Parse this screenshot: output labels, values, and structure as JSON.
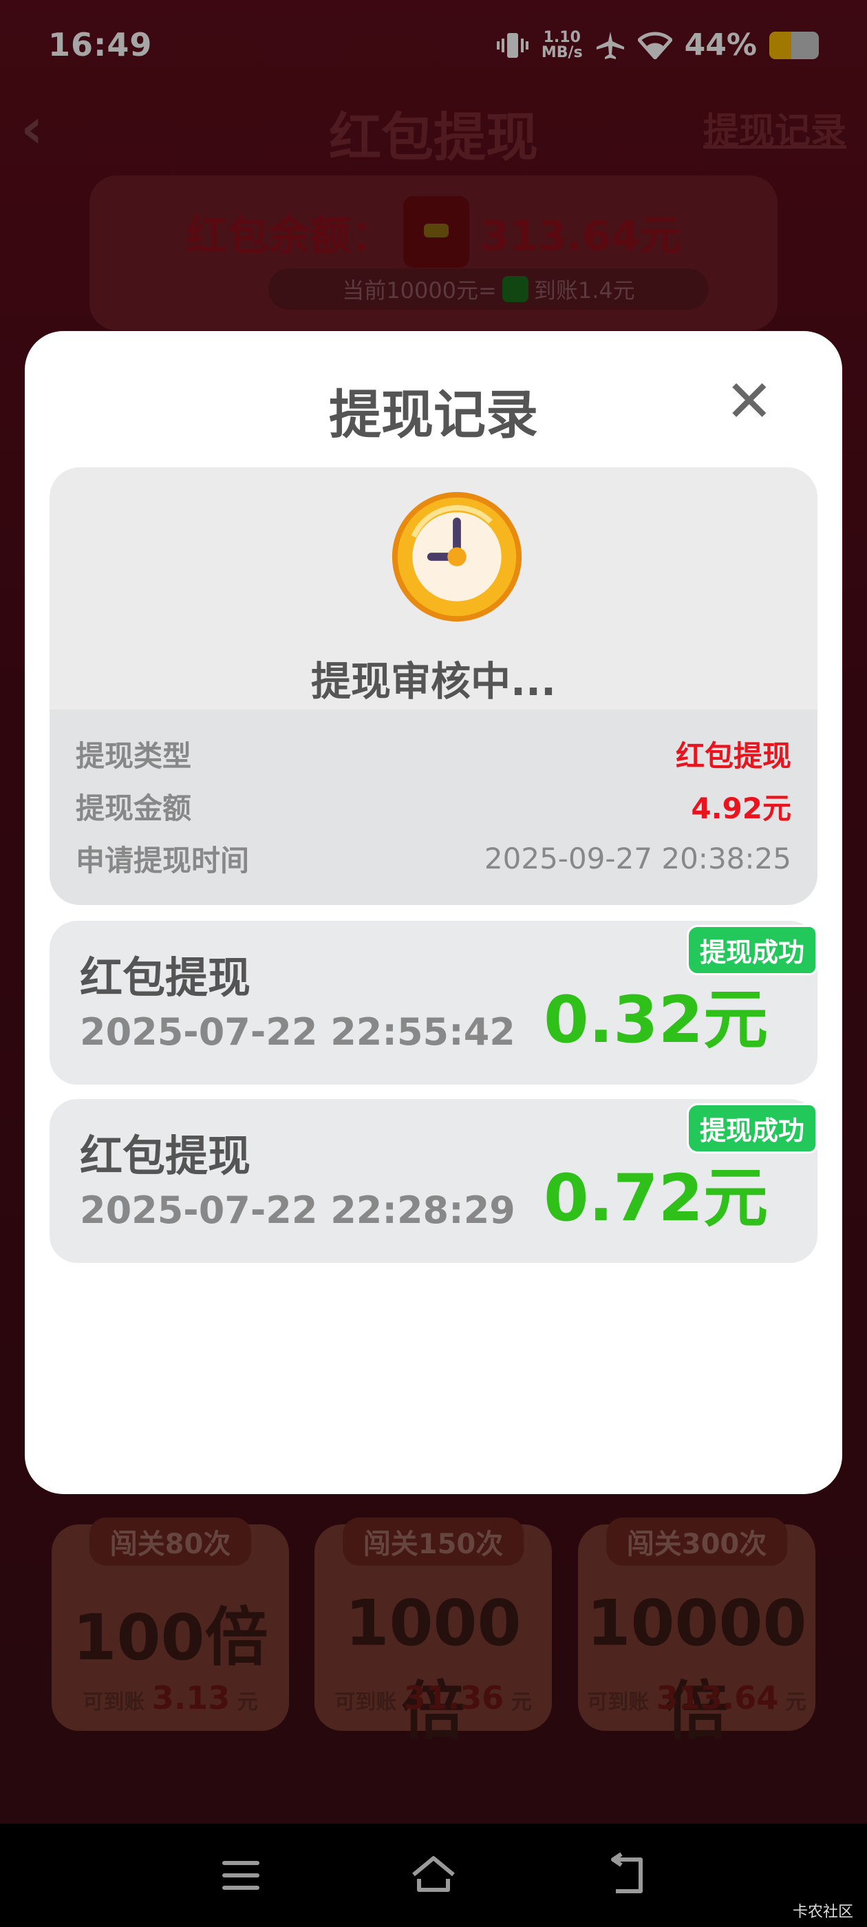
{
  "status_bar": {
    "time": "16:49",
    "speed_value": "1.10",
    "speed_unit": "MB/s",
    "battery": "44%",
    "battery_level": 0.44
  },
  "page": {
    "title": "红包提现",
    "records_link": "提现记录"
  },
  "balance": {
    "label": "红包余额：",
    "value": "313.64元",
    "rate_prefix": "当前10000元=",
    "rate_suffix": "到账1.4元"
  },
  "tiles": [
    {
      "tag": "闯关80次",
      "multiplier": "100倍",
      "payout_label": "可到账",
      "payout_amount": "3.13",
      "payout_unit": "元"
    },
    {
      "tag": "闯关150次",
      "multiplier": "1000倍",
      "payout_label": "可到账",
      "payout_amount": "31.36",
      "payout_unit": "元"
    },
    {
      "tag": "闯关300次",
      "multiplier": "10000倍",
      "payout_label": "可到账",
      "payout_amount": "313.64",
      "payout_unit": "元"
    }
  ],
  "modal": {
    "title": "提现记录",
    "close_glyph": "✕",
    "pending": {
      "status": "提现审核中...",
      "rows": [
        {
          "key": "提现类型",
          "value": "红包提现"
        },
        {
          "key": "提现金额",
          "value": "4.92元"
        },
        {
          "key": "申请提现时间",
          "value": "2025-09-27 20:38:25"
        }
      ]
    },
    "records": [
      {
        "type": "红包提现",
        "time": "2025-07-22 22:55:42",
        "amount": "0.32元",
        "badge": "提现成功"
      },
      {
        "type": "红包提现",
        "time": "2025-07-22 22:28:29",
        "amount": "0.72元",
        "badge": "提现成功"
      }
    ]
  },
  "watermark": "卡农社区",
  "colors": {
    "accent_red": "#e8141e",
    "success_green": "#2fc11a",
    "badge_green": "#22c85a"
  },
  "icons": [
    "vibrate-icon",
    "airplane-icon",
    "wifi-icon",
    "battery-icon",
    "back-chevron-icon",
    "red-envelope-icon",
    "wechat-icon",
    "close-icon",
    "clock-icon",
    "menu-icon",
    "home-icon",
    "back-icon"
  ]
}
